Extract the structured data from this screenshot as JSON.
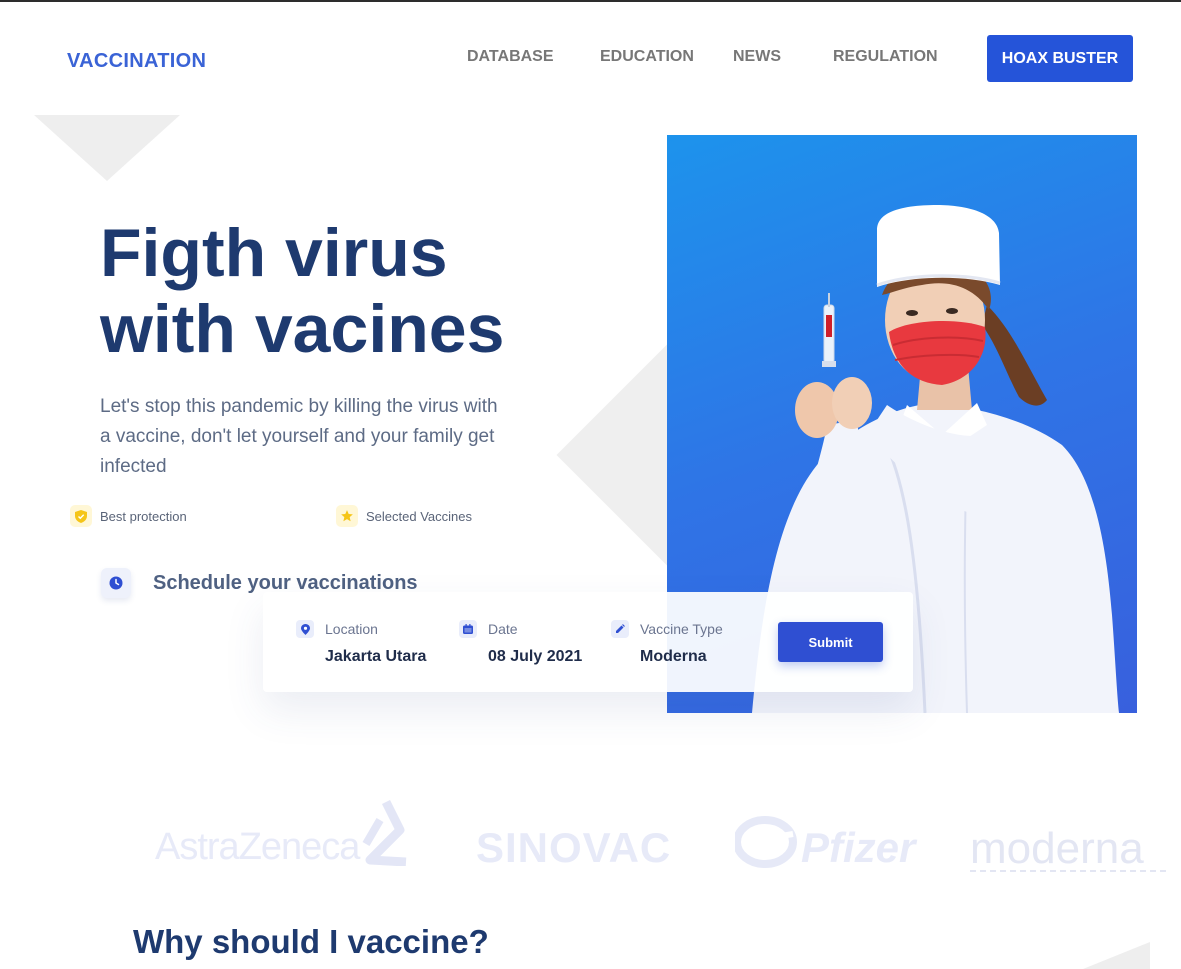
{
  "nav": {
    "brand": "VACCINATION",
    "items": [
      "DATABASE",
      "EDUCATION",
      "NEWS",
      "REGULATION"
    ],
    "cta": "HOAX BUSTER"
  },
  "hero": {
    "title_line1": "Figth virus",
    "title_line2": "with vacines",
    "subtitle": "Let's stop this pandemic by killing the virus with a vaccine, don't let yourself and your family get infected",
    "features": [
      {
        "label": "Best protection",
        "icon": "shield-icon"
      },
      {
        "label": "Selected Vaccines",
        "icon": "star-icon"
      }
    ],
    "schedule_label": "Schedule your vaccinations"
  },
  "form": {
    "location_label": "Location",
    "location_value": "Jakarta Utara",
    "date_label": "Date",
    "date_value": "08 July 2021",
    "vaccine_label": "Vaccine Type",
    "vaccine_value": "Moderna",
    "submit_label": "Submit"
  },
  "partners": {
    "astrazeneca": "AstraZeneca",
    "sinovac": "SINOVAC",
    "pfizer": "Pfizer",
    "moderna": "moderna"
  },
  "section": {
    "why_title": "Why should I vaccine?"
  },
  "colors": {
    "brand": "#3a63d6",
    "cta": "#2554d9",
    "heading": "#1e3a6f",
    "submit": "#2f4fd2"
  }
}
